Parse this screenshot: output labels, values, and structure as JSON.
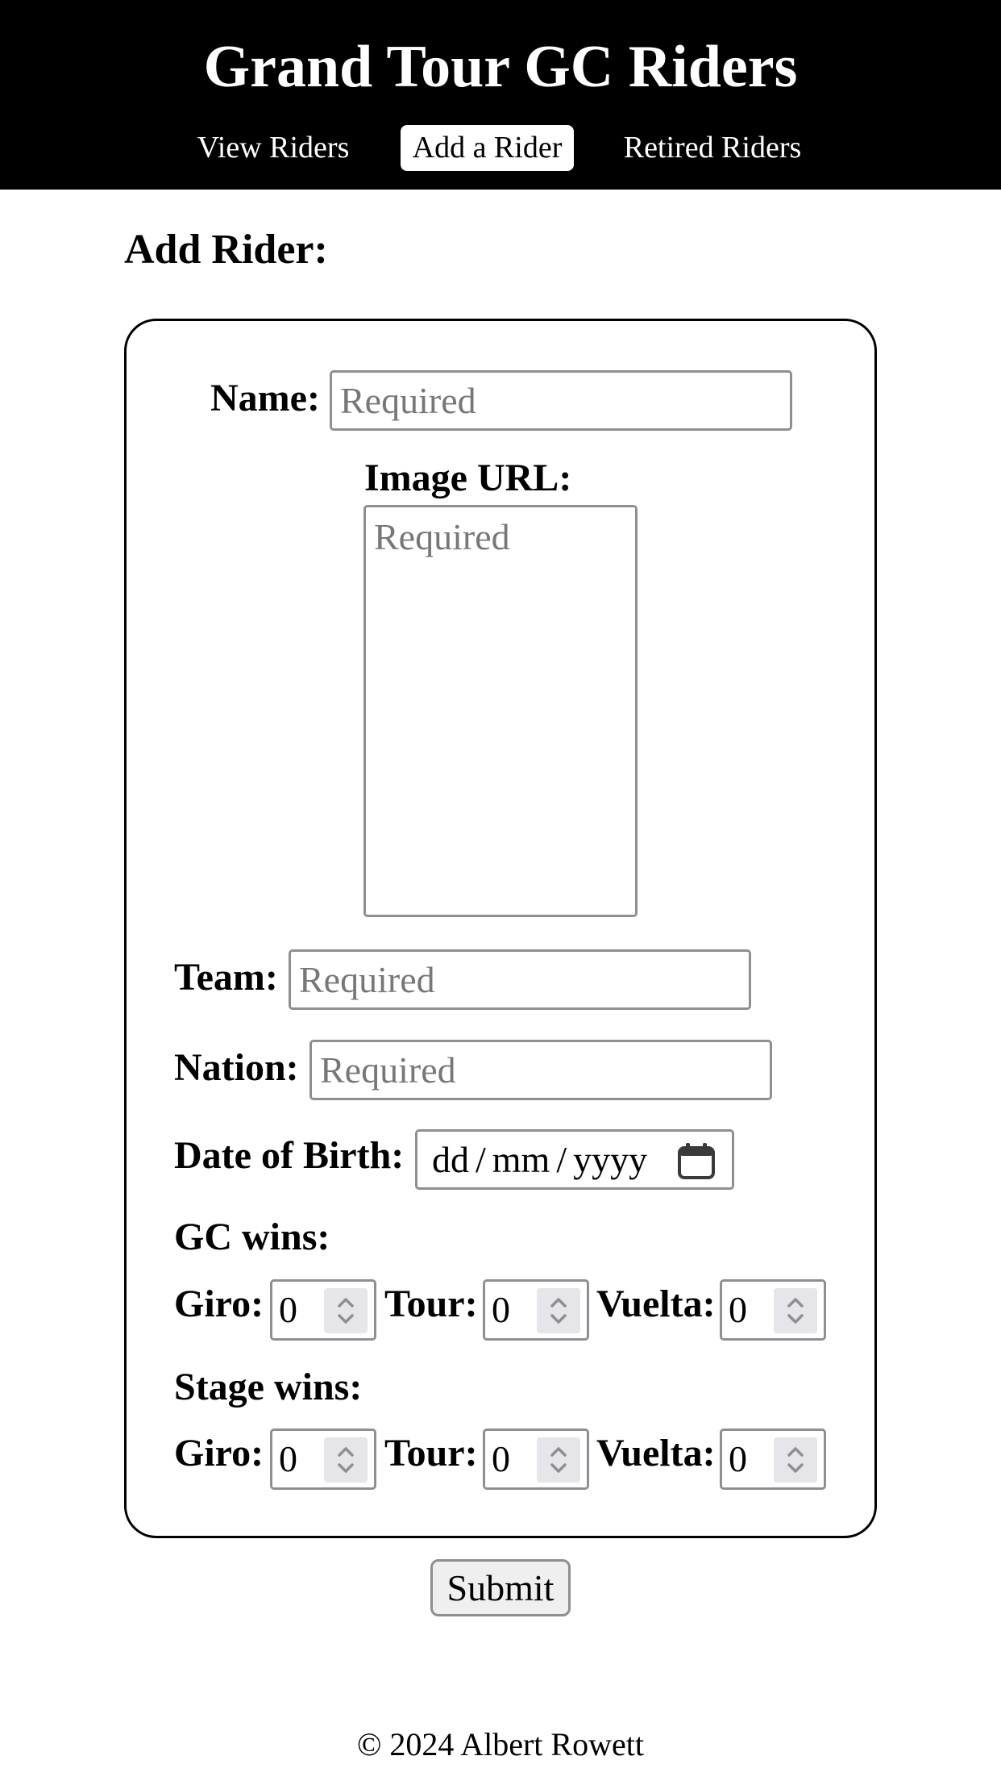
{
  "header": {
    "title": "Grand Tour GC Riders",
    "nav": [
      {
        "label": "View Riders"
      },
      {
        "label": "Add a Rider",
        "active": true
      },
      {
        "label": "Retired Riders"
      }
    ]
  },
  "main": {
    "section_title": "Add Rider:",
    "form": {
      "name": {
        "label": "Name:",
        "placeholder": "Required"
      },
      "image_url": {
        "label": "Image URL:",
        "placeholder": "Required"
      },
      "team": {
        "label": "Team:",
        "placeholder": "Required"
      },
      "nation": {
        "label": "Nation:",
        "placeholder": "Required"
      },
      "dob": {
        "label": "Date of Birth:",
        "dd": "dd",
        "mm": "mm",
        "yyyy": "yyyy",
        "sep": "/"
      },
      "gc_wins": {
        "label": "GC wins:",
        "giro": {
          "label": "Giro:",
          "value": "0"
        },
        "tour": {
          "label": "Tour:",
          "value": "0"
        },
        "vuelta": {
          "label": "Vuelta:",
          "value": "0"
        }
      },
      "stage_wins": {
        "label": "Stage wins:",
        "giro": {
          "label": "Giro:",
          "value": "0"
        },
        "tour": {
          "label": "Tour:",
          "value": "0"
        },
        "vuelta": {
          "label": "Vuelta:",
          "value": "0"
        }
      }
    },
    "submit_label": "Submit"
  },
  "footer": {
    "text": "© 2024 Albert Rowett"
  },
  "icons": {
    "calendar": "calendar-icon",
    "spinner": "chevron-up-down-icon"
  },
  "colors": {
    "header_bg": "#000000",
    "border": "#8e8e93",
    "placeholder": "#777777"
  }
}
